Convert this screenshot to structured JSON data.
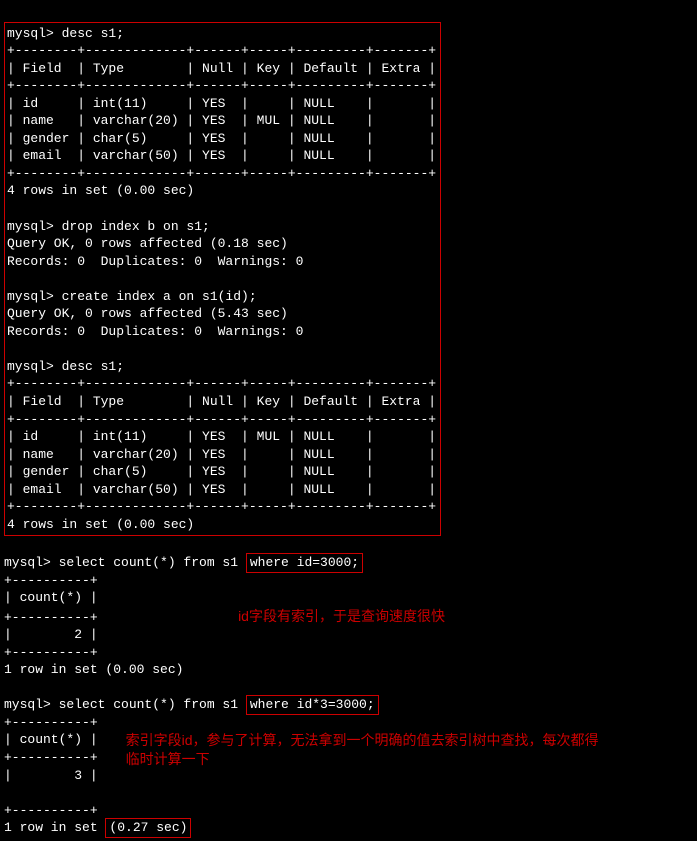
{
  "block1": {
    "cmd": "mysql> desc s1;",
    "sep1": "+--------+-------------+------+-----+---------+-------+",
    "hdr": "| Field  | Type        | Null | Key | Default | Extra |",
    "sep2": "+--------+-------------+------+-----+---------+-------+",
    "r1": "| id     | int(11)     | YES  |     | NULL    |       |",
    "r2": "| name   | varchar(20) | YES  | MUL | NULL    |       |",
    "r3": "| gender | char(5)     | YES  |     | NULL    |       |",
    "r4": "| email  | varchar(50) | YES  |     | NULL    |       |",
    "sep3": "+--------+-------------+------+-----+---------+-------+",
    "status": "4 rows in set (0.00 sec)",
    "drop_cmd": "mysql> drop index b on s1;",
    "drop_r1": "Query OK, 0 rows affected (0.18 sec)",
    "drop_r2": "Records: 0  Duplicates: 0  Warnings: 0",
    "create_cmd": "mysql> create index a on s1(id);",
    "create_r1": "Query OK, 0 rows affected (5.43 sec)",
    "create_r2": "Records: 0  Duplicates: 0  Warnings: 0",
    "cmd2": "mysql> desc s1;",
    "b2sep1": "+--------+-------------+------+-----+---------+-------+",
    "b2hdr": "| Field  | Type        | Null | Key | Default | Extra |",
    "b2sep2": "+--------+-------------+------+-----+---------+-------+",
    "b2r1": "| id     | int(11)     | YES  | MUL | NULL    |       |",
    "b2r2": "| name   | varchar(20) | YES  |     | NULL    |       |",
    "b2r3": "| gender | char(5)     | YES  |     | NULL    |       |",
    "b2r4": "| email  | varchar(50) | YES  |     | NULL    |       |",
    "b2sep3": "+--------+-------------+------+-----+---------+-------+",
    "b2status": "4 rows in set (0.00 sec)"
  },
  "query1": {
    "pre": "mysql> select count(*) from s1 ",
    "hl": "where id=3000;",
    "sep1": "+----------+",
    "hdr": "| count(*) |",
    "sep2": "+----------+",
    "val": "|        2 |",
    "sep3": "+----------+",
    "status": "1 row in set (0.00 sec)"
  },
  "annotation1": "id字段有索引，于是查询速度很快",
  "query2": {
    "pre": "mysql> select count(*) from s1 ",
    "hl": "where id*3=3000;",
    "sep1": "+----------+",
    "hdr": "| count(*) |",
    "sep2": "+----------+",
    "val": "|        3 |",
    "sep3": "+----------+",
    "status_pre": "1 row in set ",
    "status_hl": "(0.27 sec)"
  },
  "annotation2": "索引字段id，参与了计算，无法拿到一个明确的值去索引树中查找，每次都得临时计算一下"
}
